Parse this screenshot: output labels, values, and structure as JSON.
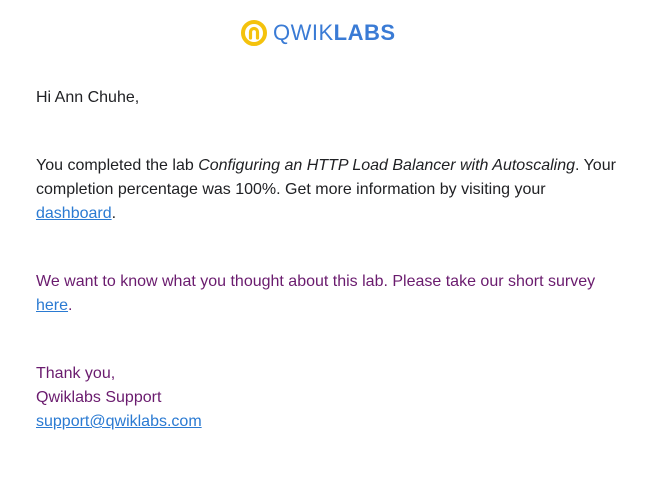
{
  "logo": {
    "text_part1": "QWIK",
    "text_part2": "LABS",
    "icon": "qwiklabs-logo-icon",
    "icon_color": "#f4c20d",
    "text_color": "#3a7bd5"
  },
  "email": {
    "greeting": "Hi Ann Chuhe,",
    "completion": {
      "prefix": "You completed the lab ",
      "lab_name": "Configuring an HTTP Load Balancer with Autoscaling",
      "middle": ". Your completion percentage was 100%. Get more information by visiting your ",
      "link_text": "dashboard",
      "suffix": "."
    },
    "survey": {
      "prefix": "We want to know what you thought about this lab. Please take our short survey ",
      "link_text": "here",
      "suffix": "."
    },
    "signoff": {
      "thanks": "Thank you,",
      "team": "Qwiklabs Support",
      "email_link": "support@qwiklabs.com"
    }
  },
  "colors": {
    "body_text": "#202124",
    "purple_text": "#6a1b6e",
    "link": "#2a7ad2"
  }
}
